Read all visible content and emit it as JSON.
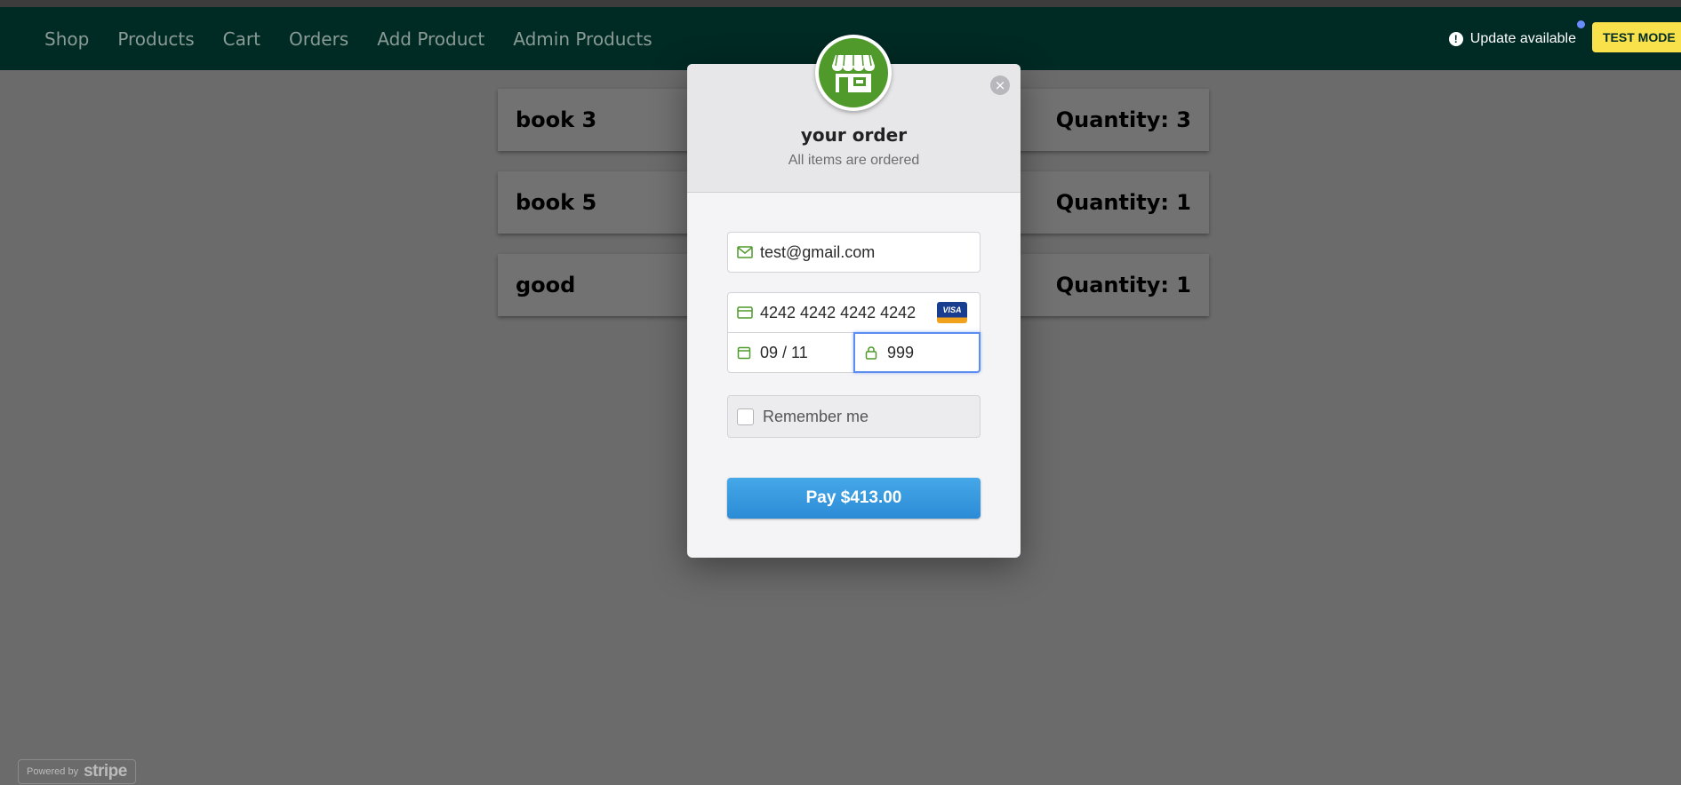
{
  "nav": {
    "links": [
      "Shop",
      "Products",
      "Cart",
      "Orders",
      "Add Product",
      "Admin Products"
    ],
    "update_label": "Update available",
    "test_mode_label": "TEST MODE"
  },
  "orders": [
    {
      "title": "book 3",
      "quantity": "Quantity: 3"
    },
    {
      "title": "book 5",
      "quantity": "Quantity: 1"
    },
    {
      "title": "good",
      "quantity": "Quantity: 1"
    }
  ],
  "modal": {
    "title": "your order",
    "subtitle": "All items are ordered",
    "close_icon": "×",
    "email_value": "test@gmail.com",
    "card_number_value": "4242 4242 4242 4242",
    "card_brand": "VISA",
    "expiry_value": "09 / 11",
    "cvc_value": "999",
    "remember_label": "Remember me",
    "pay_label": "Pay $413.00"
  },
  "footer": {
    "powered_by": "Powered by",
    "brand": "stripe"
  },
  "colors": {
    "navbar": "#002a24",
    "logo_green": "#4f9a2a",
    "pay_blue": "#2c8bd6",
    "test_mode_yellow": "#f8e14a"
  }
}
